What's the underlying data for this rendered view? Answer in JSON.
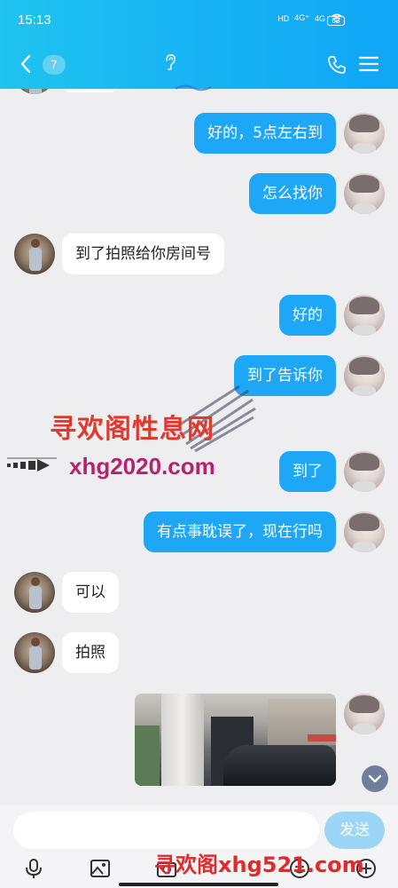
{
  "status_bar": {
    "time": "15:13",
    "network_1": "4G⁺",
    "network_2": "4G",
    "hd": "HD",
    "battery": "63"
  },
  "header": {
    "back_icon": "chevron-left-icon",
    "unread_count": "7",
    "voice_icon": "ear-icon",
    "call_icon": "phone-icon",
    "menu_icon": "menu-icon"
  },
  "messages": [
    {
      "side": "out",
      "text": "好的，5点左右到"
    },
    {
      "side": "out",
      "text": "怎么找你"
    },
    {
      "side": "in",
      "text": "到了拍照给你房间号"
    },
    {
      "side": "out",
      "text": "好的"
    },
    {
      "side": "out",
      "text": "到了告诉你"
    },
    {
      "side": "out",
      "text": "到了"
    },
    {
      "side": "out",
      "text": "有点事耽误了，现在行吗"
    },
    {
      "side": "in",
      "text": "可以"
    },
    {
      "side": "in",
      "text": "拍照"
    },
    {
      "side": "out",
      "type": "image",
      "text": ""
    }
  ],
  "watermarks": {
    "line1": "寻欢阁性息网",
    "line2": "xhg2020.com",
    "line3": "寻欢阁xhg521.com"
  },
  "input": {
    "placeholder": "",
    "send_label": "发送"
  },
  "toolbar": {
    "icons": [
      "microphone-icon",
      "image-icon",
      "camera-icon",
      "emoji-icon",
      "plus-icon"
    ]
  },
  "colors": {
    "header": "#18b3f4",
    "outgoing_bubble": "#1ea7f6",
    "incoming_bubble": "#ffffff",
    "background": "#eeeef1"
  }
}
